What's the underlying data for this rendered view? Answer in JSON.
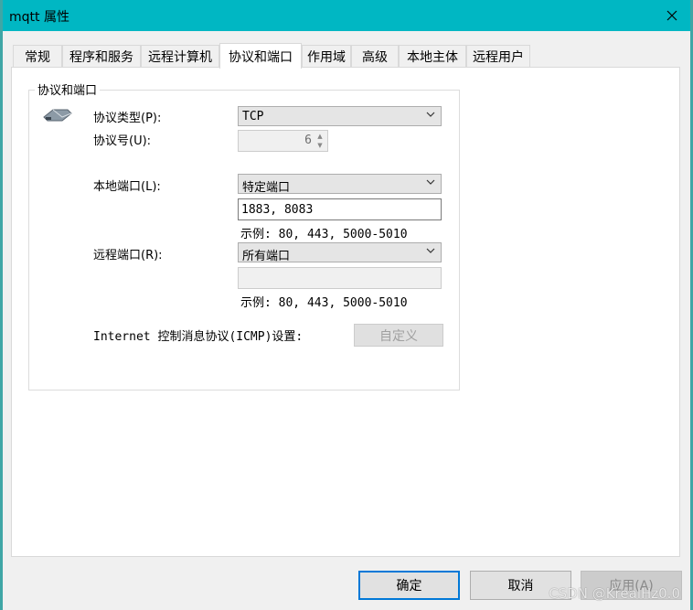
{
  "window": {
    "title": "mqtt 属性"
  },
  "tabs": [
    {
      "label": "常规"
    },
    {
      "label": "程序和服务"
    },
    {
      "label": "远程计算机"
    },
    {
      "label": "协议和端口",
      "active": true
    },
    {
      "label": "作用域"
    },
    {
      "label": "高级"
    },
    {
      "label": "本地主体"
    },
    {
      "label": "远程用户"
    }
  ],
  "group": {
    "title": "协议和端口",
    "protocol_type": {
      "label": "协议类型(P):",
      "value": "TCP"
    },
    "protocol_number": {
      "label": "协议号(U):",
      "value": "6"
    },
    "local_port": {
      "label": "本地端口(L):",
      "value": "特定端口",
      "ports": "1883, 8083",
      "example": "示例: 80, 443, 5000-5010"
    },
    "remote_port": {
      "label": "远程端口(R):",
      "value": "所有端口",
      "ports": "",
      "example": "示例: 80, 443, 5000-5010"
    },
    "icmp": {
      "label": "Internet 控制消息协议(ICMP)设置:",
      "button": "自定义"
    }
  },
  "footer": {
    "ok": "确定",
    "cancel": "取消",
    "apply": "应用(A)"
  },
  "watermark": "CSDN @KrealHz0.0",
  "icons": {
    "close": "close-icon",
    "network": "network-protocol-icon"
  }
}
